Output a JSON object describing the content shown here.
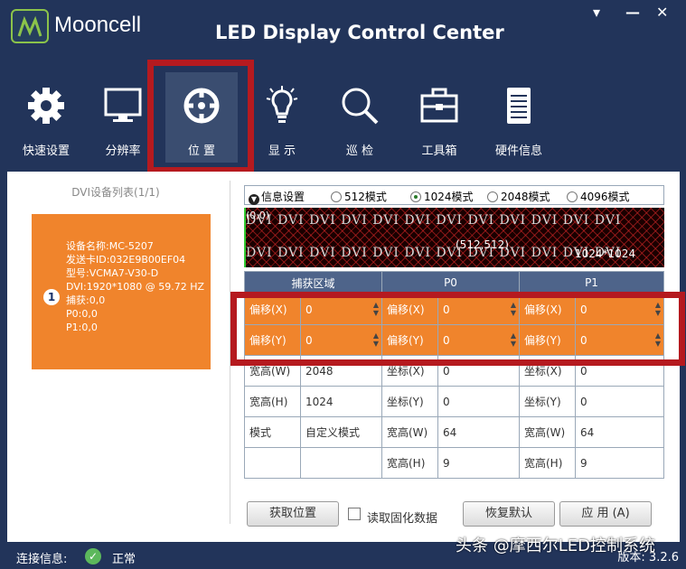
{
  "app": {
    "logo_text": "Mooncell",
    "title": "LED Display Control Center"
  },
  "window": {
    "menu_icon": "▾",
    "minimize_icon": "—",
    "close_icon": "✕"
  },
  "nav": [
    {
      "label": "快速设置",
      "icon": "gear-icon"
    },
    {
      "label": "分辨率",
      "icon": "monitor-icon"
    },
    {
      "label": "位 置",
      "icon": "crosshair-icon"
    },
    {
      "label": "显 示",
      "icon": "lightbulb-icon"
    },
    {
      "label": "巡 检",
      "icon": "magnifier-icon"
    },
    {
      "label": "工具箱",
      "icon": "toolbox-icon"
    },
    {
      "label": "硬件信息",
      "icon": "chip-icon"
    }
  ],
  "device_list": {
    "title": "DVI设备列表(1/1)",
    "badge": "1",
    "lines": [
      "设备名称:MC-5207",
      "发送卡ID:032E9B00EF04",
      "型号:VCMA7-V30-D",
      "DVI:1920*1080  @  59.72 HZ",
      "捕获:0,0",
      "P0:0,0",
      "P1:0,0"
    ]
  },
  "modes": {
    "info": "信息设置",
    "options": [
      {
        "label": "512模式",
        "selected": false
      },
      {
        "label": "1024模式",
        "selected": true
      },
      {
        "label": "2048模式",
        "selected": false
      },
      {
        "label": "4096模式",
        "selected": false
      }
    ]
  },
  "preview": {
    "origin": "(0,0)",
    "row_text": "DVI DVI DVI DVI DVI DVI DVI DVI DVI DVI DVI DVI",
    "mid": "(512,512)",
    "size": "1024*1024"
  },
  "table": {
    "headers": [
      "捕获区域",
      "P0",
      "P1"
    ],
    "offset_x": {
      "label": "偏移(X)",
      "values": [
        "0",
        "0",
        "0"
      ]
    },
    "offset_y": {
      "label": "偏移(Y)",
      "values": [
        "0",
        "0",
        "0"
      ]
    },
    "rows": [
      [
        "宽高(W)",
        "2048",
        "坐标(X)",
        "0",
        "坐标(X)",
        "0"
      ],
      [
        "宽高(H)",
        "1024",
        "坐标(Y)",
        "0",
        "坐标(Y)",
        "0"
      ],
      [
        "模式",
        "自定义模式",
        "宽高(W)",
        "64",
        "宽高(W)",
        "64"
      ],
      [
        "",
        "",
        "宽高(H)",
        "9",
        "宽高(H)",
        "9"
      ]
    ]
  },
  "buttons": {
    "get_position": "获取位置",
    "read_fixed": "读取固化数据",
    "restore": "恢复默认",
    "apply": "应 用 (A)"
  },
  "status": {
    "label": "连接信息:",
    "value": "正常",
    "version": "版本: 3.2.6"
  },
  "watermark": "头条 @摩西尔LED控制系统",
  "colors": {
    "bg": "#22345a",
    "accent_orange": "#f0842c",
    "highlight_red": "#b51a1f",
    "header_blue": "#4e648a"
  }
}
